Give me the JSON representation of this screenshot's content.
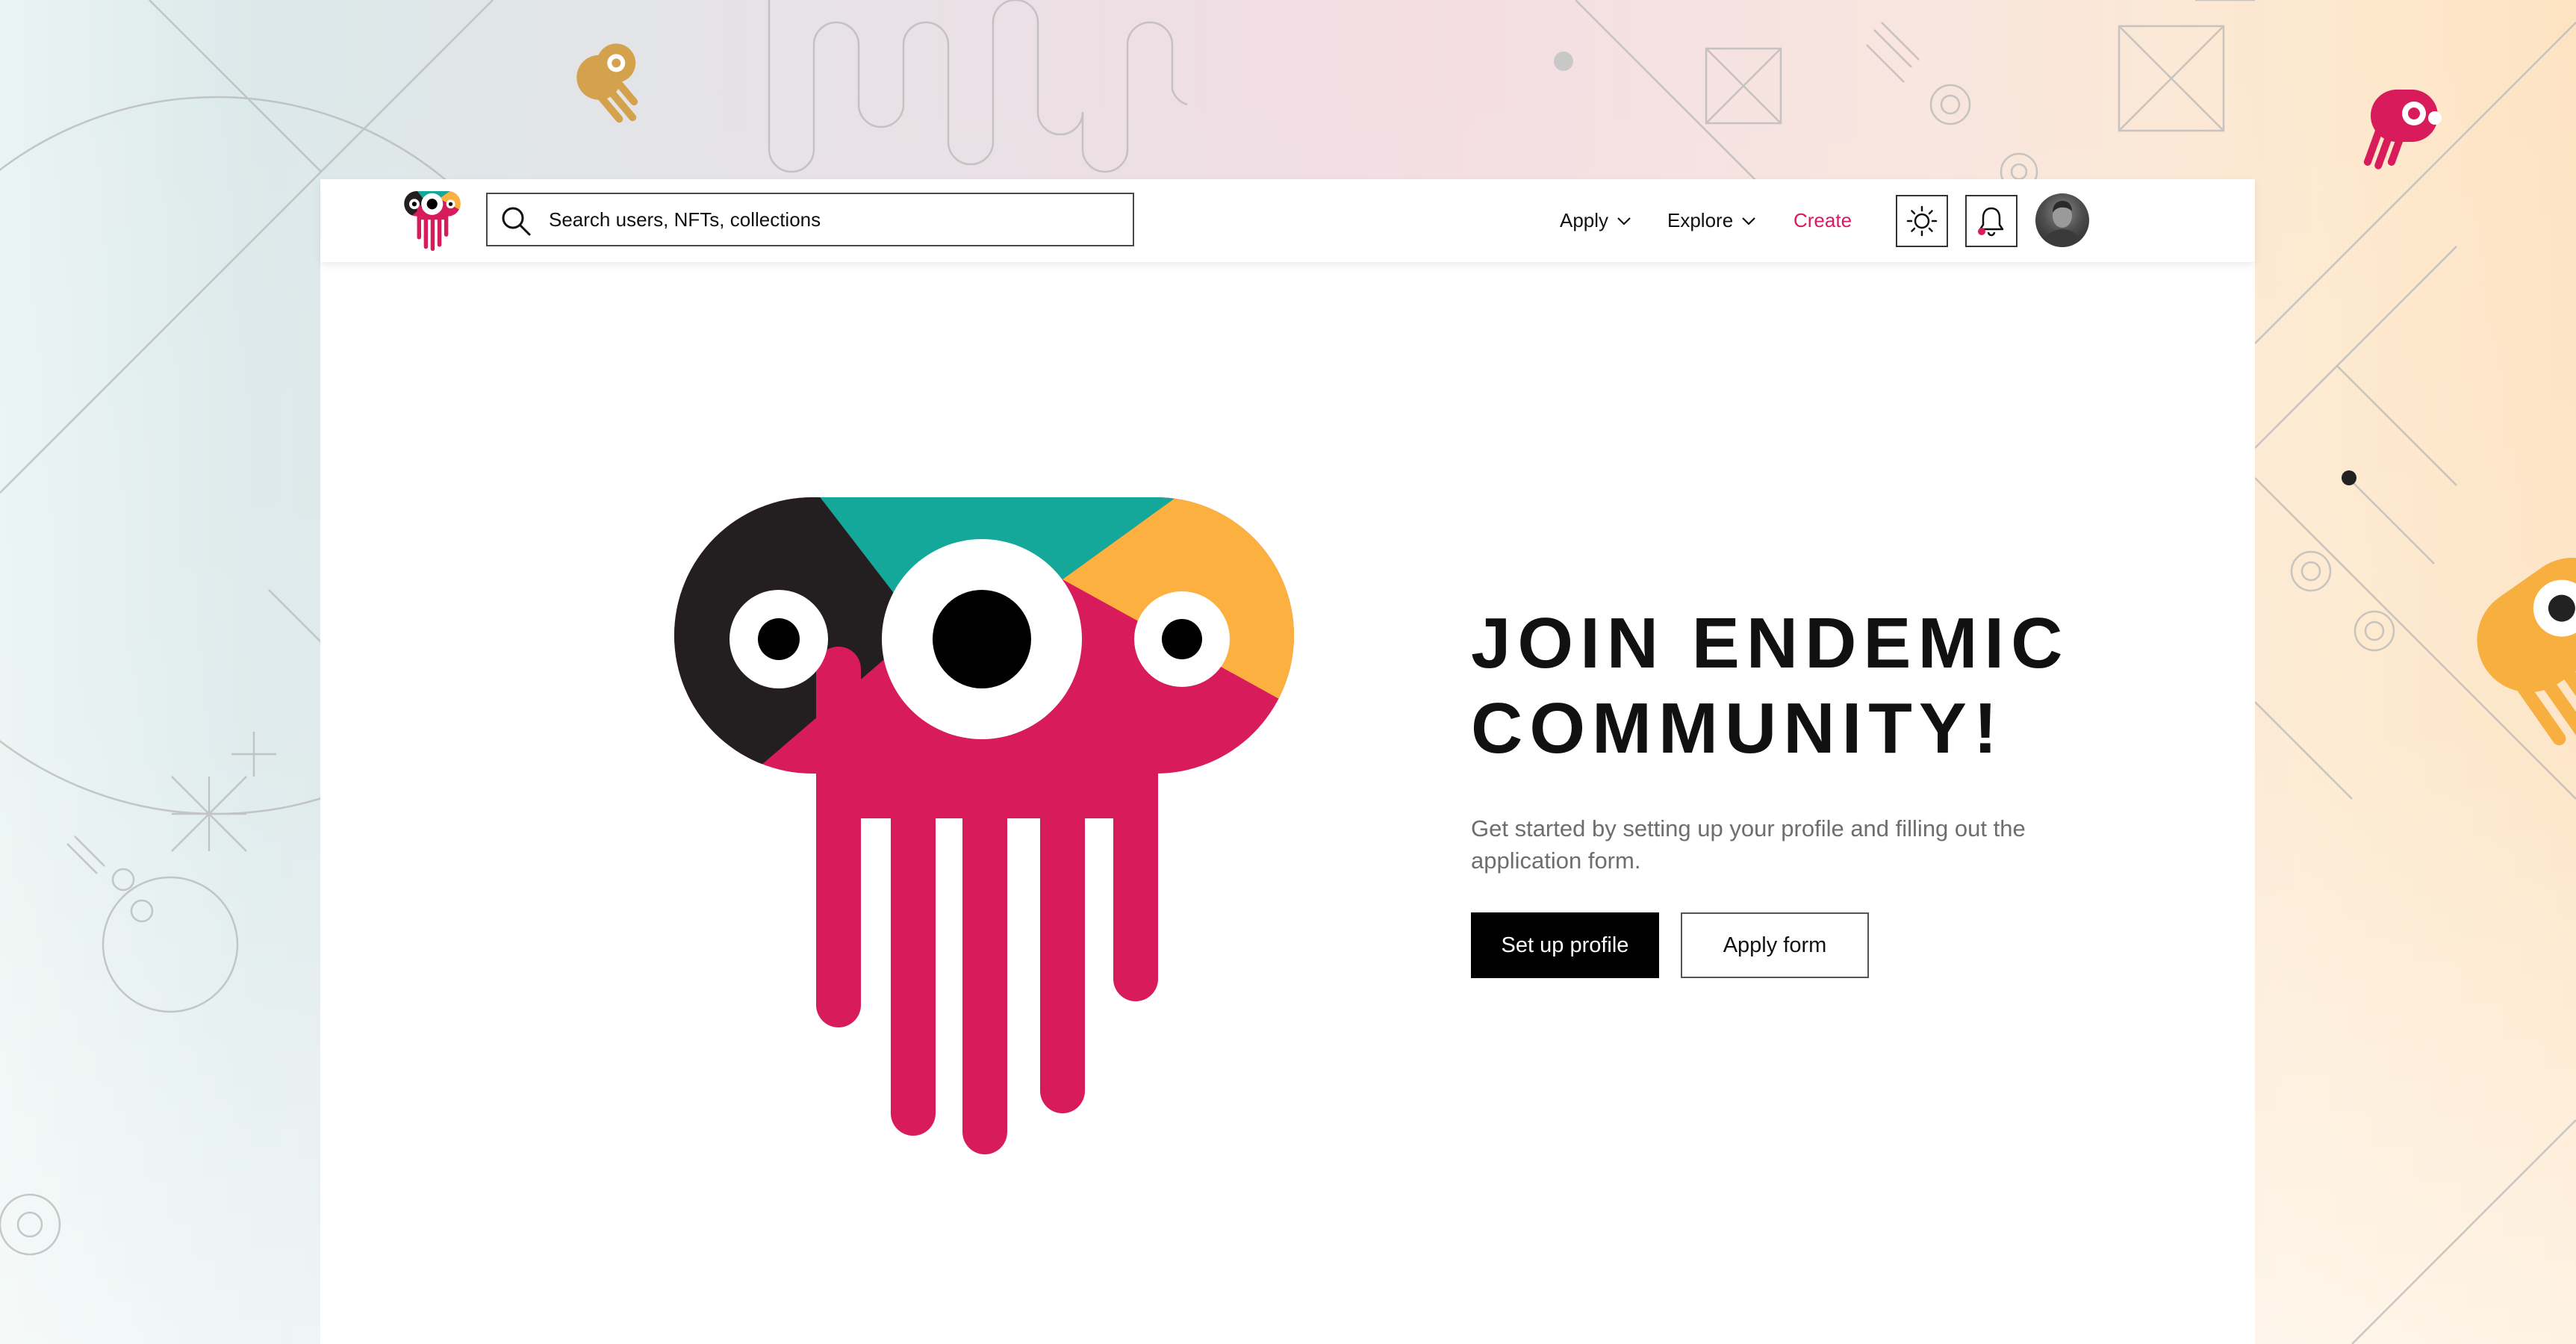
{
  "header": {
    "search": {
      "placeholder": "Search users, NFTs, collections",
      "value": ""
    },
    "nav": {
      "apply": "Apply",
      "explore": "Explore",
      "create": "Create"
    },
    "theme_toggle_icon": "sun-icon",
    "notifications_icon": "bell-icon",
    "avatar_icon": "user-avatar"
  },
  "hero": {
    "headline_line1": "JOIN ENDEMIC",
    "headline_line2": "COMMUNITY!",
    "subtitle": "Get started by setting up your profile and filling out the application form.",
    "primary_button": "Set up profile",
    "secondary_button": "Apply form"
  },
  "colors": {
    "brand_pink": "#d81b5b",
    "brand_teal": "#14a89a",
    "brand_orange": "#fbb040",
    "brand_black": "#231f20",
    "create_link": "#d81b60"
  }
}
